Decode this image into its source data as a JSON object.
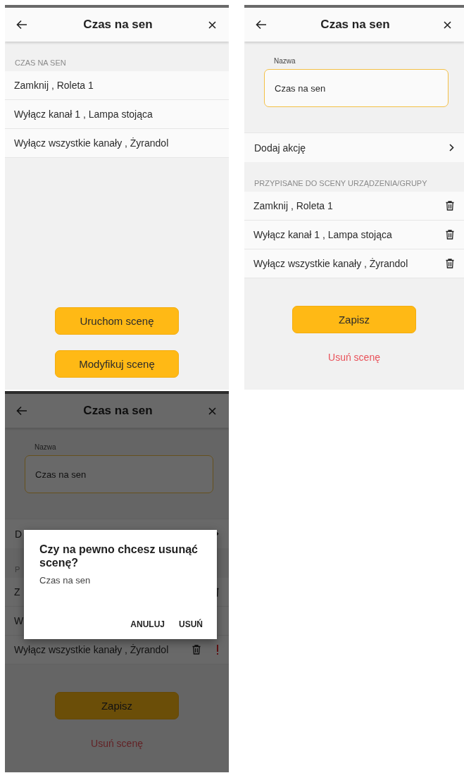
{
  "screens": [
    {
      "kind": "scene_view",
      "header": {
        "title": "Czas na sen"
      },
      "section_title": "CZAS NA SEN",
      "actions": [
        {
          "text": "Zamknij , Roleta 1",
          "deletable": false,
          "warning": false
        },
        {
          "text": "Wyłącz kanał 1 , Lampa stojąca",
          "deletable": false,
          "warning": false
        },
        {
          "text": "Wyłącz wszystkie kanały , Żyrandol",
          "deletable": false,
          "warning": false
        }
      ],
      "buttons": [
        "Uruchom scenę",
        "Modyfikuj scenę"
      ]
    },
    {
      "kind": "scene_edit",
      "header": {
        "title": "Czas na sen"
      },
      "name_field": {
        "label": "Nazwa",
        "value": "Czas na sen"
      },
      "add_action": "Dodaj akcję",
      "section_title": "PRZYPISANE DO SCENY URZĄDZENIA/GRUPY",
      "actions": [
        {
          "text": "Zamknij , Roleta 1",
          "deletable": true,
          "warning": false
        },
        {
          "text": "Wyłącz kanał 1 , Lampa stojąca",
          "deletable": true,
          "warning": false
        },
        {
          "text": "Wyłącz wszystkie kanały , Żyrandol",
          "deletable": true,
          "warning": false
        }
      ],
      "save": "Zapisz",
      "delete": "Usuń scenę",
      "dimmed": false
    },
    {
      "kind": "scene_edit",
      "header": {
        "title": "Czas na sen"
      },
      "name_field": {
        "label": "Nazwa",
        "value": "Czas na sen"
      },
      "add_action": "D",
      "section_title": "P",
      "actions": [
        {
          "text": "Z",
          "deletable": true,
          "warning": false
        },
        {
          "text": "W",
          "deletable": false,
          "warning": false
        },
        {
          "text": "Wyłącz wszystkie kanały , Żyrandol",
          "deletable": true,
          "warning": true
        }
      ],
      "save": "Zapisz",
      "delete": "Usuń scenę",
      "dimmed": true,
      "dialog": {
        "title": "Czy na pewno chcesz usunąć scenę?",
        "message": "Czas na sen",
        "buttons": [
          "ANULUJ",
          "USUŃ"
        ]
      }
    }
  ]
}
